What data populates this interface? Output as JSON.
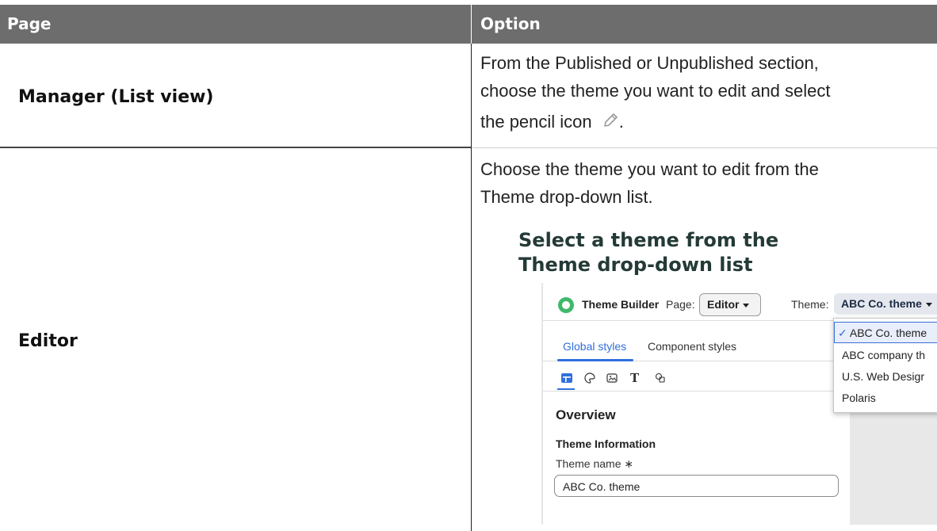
{
  "table": {
    "headers": {
      "page": "Page",
      "option": "Option"
    },
    "rows": [
      {
        "page": "Manager (List view)",
        "option_line1": "From the Published or Unpublished section,",
        "option_line2": "choose the theme you want to edit and select",
        "option_line3": "the pencil icon",
        "option_line3_end": ".",
        "icon": "pencil-icon"
      },
      {
        "page": "Editor",
        "option_line1": "Choose the theme you want to edit from the",
        "option_line2": "Theme drop-down list.",
        "figure_caption": "Select a theme from the Theme drop-down list"
      }
    ]
  },
  "screenshot": {
    "app_name": "Theme Builder",
    "page_label": "Page:",
    "page_value": "Editor",
    "theme_label": "Theme:",
    "theme_value": "ABC Co. theme",
    "tabs": [
      "Global styles",
      "Component styles"
    ],
    "toolbar_icons": [
      "layout-icon",
      "palette-icon",
      "image-icon",
      "typography-icon",
      "shapes-icon"
    ],
    "section_title": "Overview",
    "subsection_title": "Theme Information",
    "field_label": "Theme name",
    "field_required_mark": "∗",
    "field_value": "ABC Co. theme",
    "dropdown_items": [
      "ABC Co. theme",
      "ABC company th",
      "U.S. Web Desigr",
      "Polaris"
    ],
    "dropdown_selected_mark": "✓",
    "colors": {
      "accent": "#2f6fdd",
      "header_bg": "#6d6d6d",
      "logo": "#3fb96b",
      "caption": "#243a36"
    }
  }
}
